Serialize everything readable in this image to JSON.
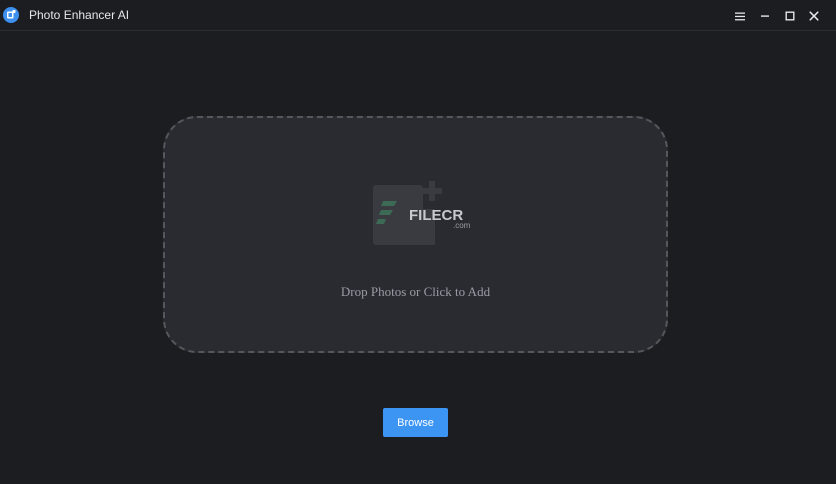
{
  "window": {
    "title": "Photo Enhancer AI",
    "controls": [
      "menu-icon",
      "minimize-icon",
      "maximize-icon",
      "close-icon"
    ]
  },
  "dropzone": {
    "prompt": "Drop Photos or Click to Add",
    "watermark_text": "FILECR",
    "watermark_suffix": ".com"
  },
  "actions": {
    "browse_label": "Browse"
  },
  "colors": {
    "background": "#1c1d21",
    "dropzone_fill": "#2a2b31",
    "accent": "#3d95f3",
    "title_text": "#e6e7ea",
    "prompt_text": "#9a9ca4"
  }
}
